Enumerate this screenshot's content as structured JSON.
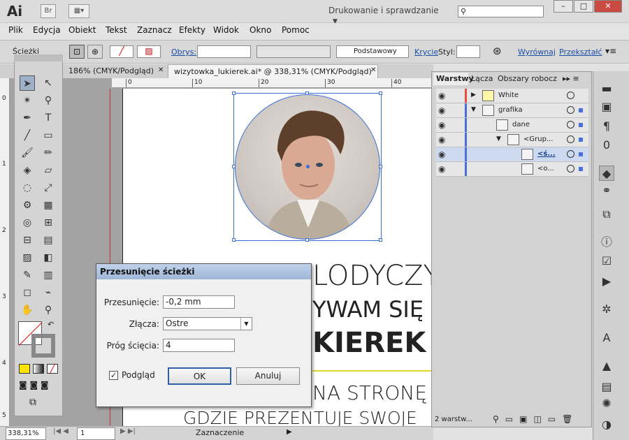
{
  "app": {
    "logo": "Ai",
    "bridge_label": "Br",
    "workspace": "Drukowanie i sprawdzanie"
  },
  "menu": [
    "Plik",
    "Edycja",
    "Obiekt",
    "Tekst",
    "Zaznacz",
    "Efekty",
    "Widok",
    "Okno",
    "Pomoc"
  ],
  "control": {
    "panel_name": "Ścieżki",
    "stroke_label": "Obrys:",
    "brush_label": "Podstawowy",
    "opacity_label": "Krycie",
    "style_label": "Styl:",
    "align_label": "Wyrównaj",
    "transform_label": "Przekształć"
  },
  "tabs": [
    {
      "label": "186% (CMYK/Podgląd)"
    },
    {
      "label": "wizytowka_lukierek.ai* @ 338,31% (CMYK/Podgląd)"
    }
  ],
  "ruler": {
    "h_ticks": [
      "0",
      "10",
      "20",
      "30",
      "40"
    ],
    "v_ticks": [
      "0",
      "1",
      "2",
      "3",
      "4",
      "5"
    ]
  },
  "artboard_text": {
    "line1": "LODYCZY",
    "line2": "YWAM SIĘ",
    "line3": "KIEREK",
    "line4": "NA STRONĘ",
    "line5": "GDZIE PREZENTUJE SWOJE"
  },
  "status": {
    "zoom": "338,31%",
    "page": "1",
    "mode": "Zaznaczenie"
  },
  "layers_panel": {
    "tabs": [
      "Warstwy",
      "Łącza",
      "Obszary robocz"
    ],
    "rows": [
      {
        "name": "White",
        "color": "#e74c3c"
      },
      {
        "name": "grafika",
        "color": "#4a70d8"
      },
      {
        "name": "dane",
        "color": "#4a70d8"
      },
      {
        "name": "<Grup...",
        "color": "#4a70d8"
      },
      {
        "name": "<ś...",
        "color": "#4a70d8"
      },
      {
        "name": "<o...",
        "color": "#4a70d8"
      }
    ],
    "footer": "2 warstw..."
  },
  "dialog": {
    "title": "Przesunięcie ścieżki",
    "offset_label": "Przesunięcie:",
    "offset_value": "-0,2 mm",
    "joins_label": "Złącza:",
    "joins_value": "Ostre",
    "miter_label": "Próg ścięcia:",
    "miter_value": "4",
    "preview_label": "Podgląd",
    "ok_label": "OK",
    "cancel_label": "Anuluj"
  }
}
